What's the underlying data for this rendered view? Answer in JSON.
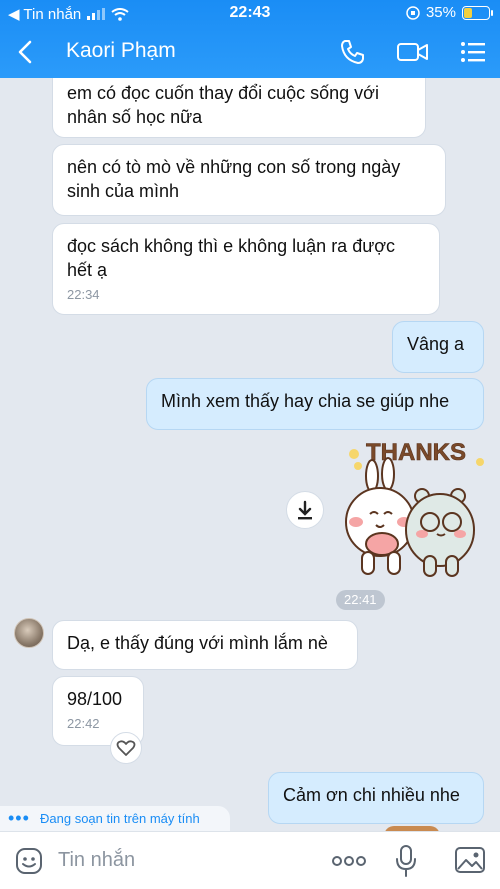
{
  "status_bar": {
    "carrier": "◀ Tin nhắn",
    "time": "22:43",
    "battery": "35%",
    "battery_level": 0.35
  },
  "header": {
    "title": "Kaori Phạm",
    "icons": [
      "back-icon",
      "phone-icon",
      "video-call-icon",
      "menu-list-icon"
    ]
  },
  "messages": {
    "m1": {
      "text": "em có đọc cuốn thay đổi cuộc sống với\nnhân số học nữa"
    },
    "m2": {
      "text": "nên có tò mò về những con số trong ngày\nsinh của mình"
    },
    "m3": {
      "text": "đọc sách không thì e không luận ra được\nhết ạ",
      "time": "22:34"
    },
    "m4": {
      "text": "Vâng a"
    },
    "m5": {
      "text": "Mình xem thấy hay chia se giúp nhe"
    },
    "sticker": {
      "text": "THANKS",
      "time": "22:41",
      "icon": "download-icon"
    },
    "m6": {
      "text": "Dạ, e thấy đúng với mình lắm nè"
    },
    "m7": {
      "text": "98/100",
      "time": "22:42",
      "react_icon": "heart-icon"
    },
    "m8": {
      "text": "Cảm ơn chi nhiều nhe"
    }
  },
  "typing_indicator": "Đang soạn tin trên máy tính",
  "composer": {
    "placeholder": "Tin nhắn",
    "icons": [
      "sticker-icon",
      "more-icon",
      "microphone-icon",
      "image-icon"
    ]
  },
  "colors": {
    "header": "#1a8df5",
    "background": "#e3e8ef",
    "outgoing_bubble": "#d5ecfe",
    "incoming_bubble": "#ffffff"
  }
}
